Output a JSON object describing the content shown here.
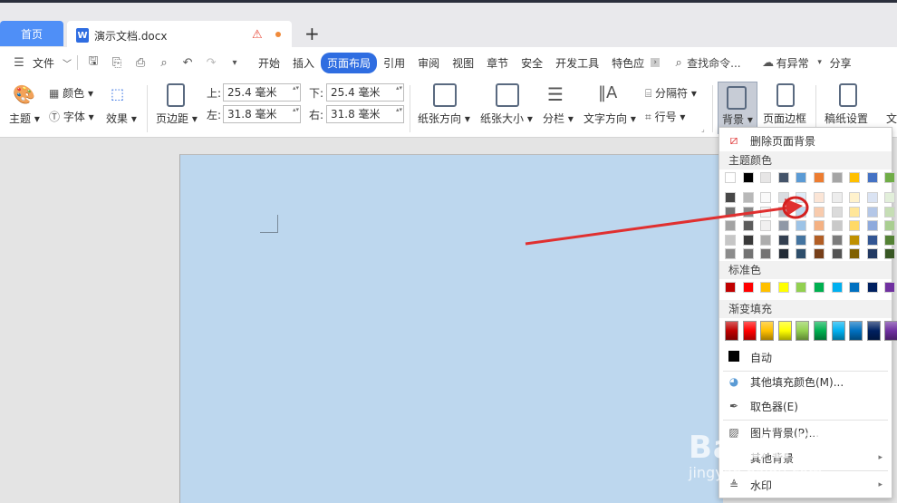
{
  "tabs": {
    "home": "首页",
    "doc_title": "演示文档.docx",
    "new_tab": "+"
  },
  "menu": {
    "file": "文件",
    "items": [
      "开始",
      "插入",
      "页面布局",
      "引用",
      "审阅",
      "视图",
      "章节",
      "安全",
      "开发工具",
      "特色应"
    ],
    "search": "查找命令...",
    "status": "有异常",
    "share": "分享"
  },
  "ribbon": {
    "theme": "主题",
    "color": "颜色",
    "font": "字体",
    "effect": "效果",
    "margins": "页边距",
    "top_label": "上:",
    "top_value": "25.4 毫米",
    "bottom_label": "下:",
    "bottom_value": "25.4 毫米",
    "left_label": "左:",
    "left_value": "31.8 毫米",
    "right_label": "右:",
    "right_value": "31.8 毫米",
    "orientation": "纸张方向",
    "size": "纸张大小",
    "columns": "分栏",
    "text_direction": "文字方向",
    "breaks": "分隔符",
    "line_numbers": "行号",
    "background": "背景",
    "page_border": "页面边框",
    "grid_paper": "稿纸设置",
    "more": "文"
  },
  "dropdown": {
    "remove_bg": "删除页面背景",
    "theme_colors": "主题颜色",
    "standard_colors": "标准色",
    "gradient_fill": "渐变填充",
    "auto": "自动",
    "more_fill": "其他填充颜色(M)...",
    "eyedropper": "取色器(E)",
    "image_bg": "图片背景(P)...",
    "other_bg": "其他背景",
    "watermark": "水印"
  },
  "colors": {
    "theme_top": [
      "#ffffff",
      "#000000",
      "#e7e6e6",
      "#44546a",
      "#5b9bd5",
      "#ed7d31",
      "#a5a5a5",
      "#ffc000",
      "#4472c4",
      "#70ad47"
    ],
    "standard": [
      "#c00000",
      "#ff0000",
      "#ffc000",
      "#ffff00",
      "#92d050",
      "#00b050",
      "#00b0f0",
      "#0070c0",
      "#002060",
      "#7030a0"
    ],
    "page_bg": "#bdd7ee",
    "accent": "#2f6de1"
  },
  "watermark": {
    "text": "Baidu经验",
    "url": "jingyan.baidu.com"
  }
}
